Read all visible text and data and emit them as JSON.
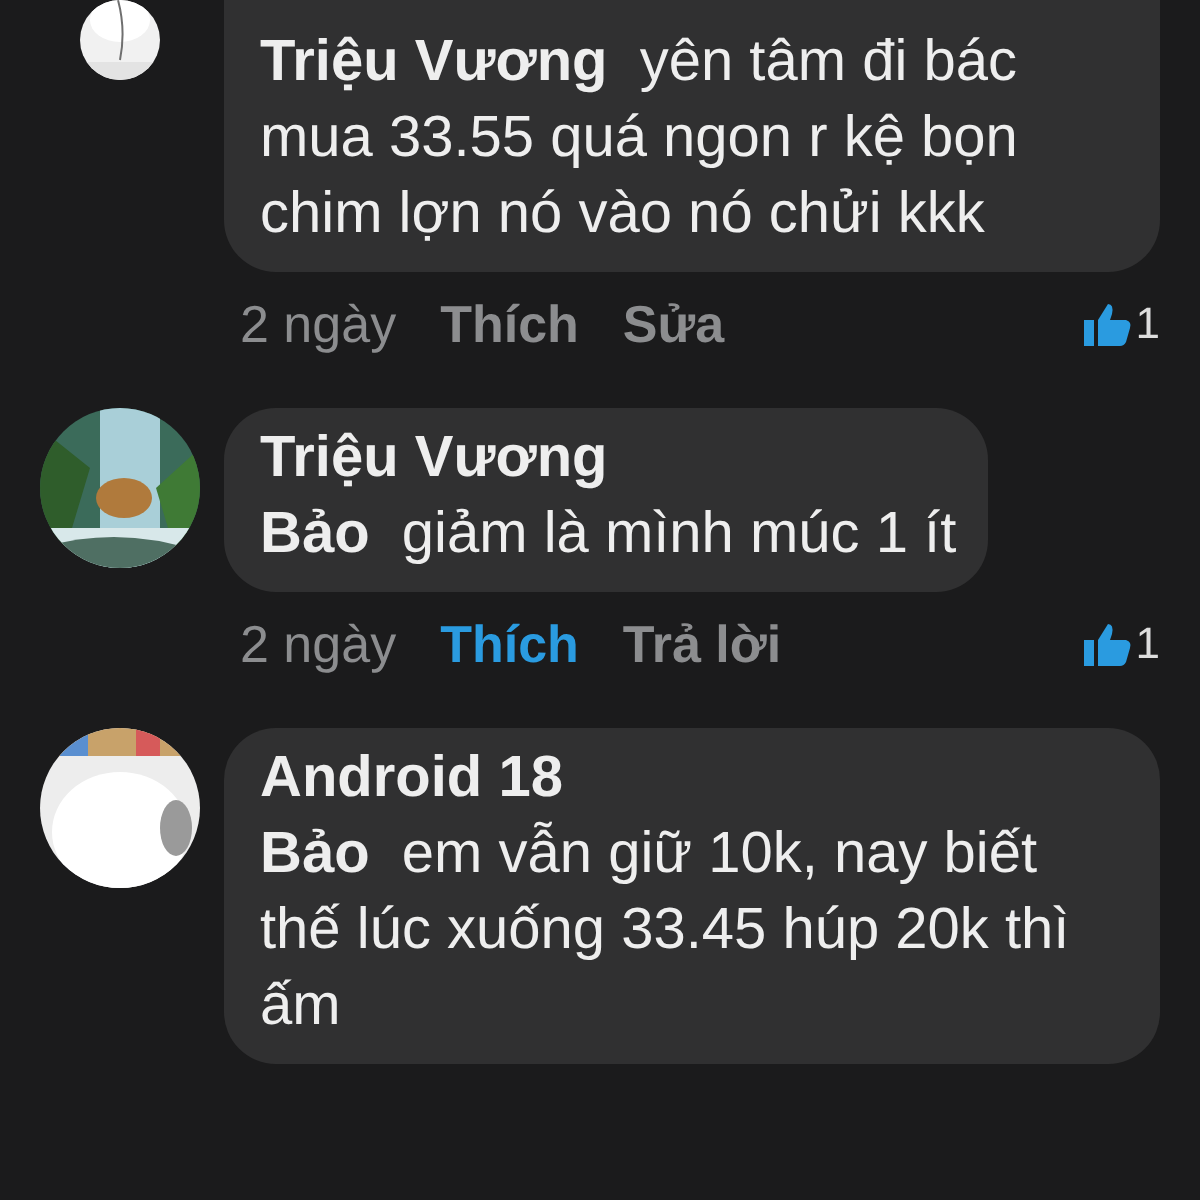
{
  "comments": [
    {
      "cut_top": true,
      "body": "**Triệu Vương**  yên tâm đi bác mua 33.55 quá ngon r kệ bọn chim lợn nó vào nó chửi kkk",
      "time": "2 ngày",
      "like_label": "Thích",
      "liked": false,
      "action": "Sửa",
      "reactions": "1"
    },
    {
      "cut_top": false,
      "author": "Triệu Vương",
      "body": "**Bảo**  giảm là mình múc 1 ít",
      "time": "2 ngày",
      "like_label": "Thích",
      "liked": true,
      "action": "Trả lời",
      "reactions": "1"
    },
    {
      "cut_top": false,
      "author": "Android 18",
      "body": "**Bảo**  em vẫn giữ 10k, nay biết thế lúc xuống 33.45 húp 20k thì ấm"
    }
  ]
}
